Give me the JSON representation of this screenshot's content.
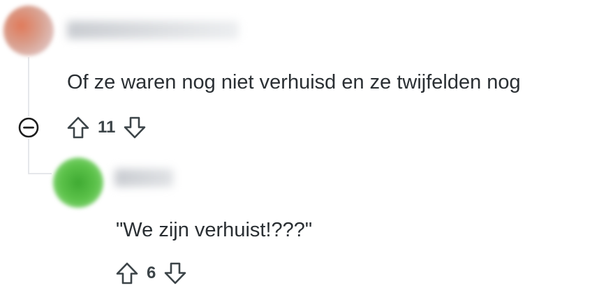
{
  "comments": [
    {
      "avatar_color": "#d9a08f",
      "username": "",
      "text": "Of ze waren nog niet verhuisd en ze twijfelden nog",
      "votes": "11",
      "upvote_icon": "upvote-arrow-icon",
      "downvote_icon": "downvote-arrow-icon"
    },
    {
      "avatar_color": "#5cc24a",
      "username": "",
      "text": "\"We zijn verhuist!???\"",
      "votes": "6",
      "upvote_icon": "upvote-arrow-icon",
      "downvote_icon": "downvote-arrow-icon"
    }
  ],
  "thread": {
    "collapse_icon": "collapse-minus-icon",
    "line_color": "#e5e7eb"
  }
}
